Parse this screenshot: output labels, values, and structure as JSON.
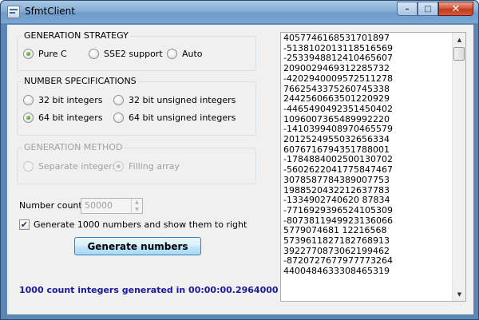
{
  "window": {
    "title": "SfmtClient"
  },
  "caption": {
    "minimize": "–",
    "maximize": "□",
    "close": "✕"
  },
  "strategy": {
    "title": "GENERATION STRATEGY",
    "options": [
      "Pure C",
      "SSE2 support",
      "Auto"
    ],
    "selected": "Pure C"
  },
  "specs": {
    "title": "NUMBER SPECIFICATIONS",
    "options": [
      "32 bit integers",
      "32 bit unsigned integers",
      "64 bit integers",
      "64 bit unsigned integers"
    ],
    "selected": "64 bit integers"
  },
  "method": {
    "title": "GENERATION METHOD",
    "options": [
      "Separate integers",
      "Filling array"
    ],
    "selected": "Filling array"
  },
  "count": {
    "label": "Number count :",
    "value": "50000"
  },
  "show_option": {
    "label": "Generate 1000 numbers and show them to right",
    "checked": true
  },
  "generate_button": {
    "label": "Generate numbers"
  },
  "status": {
    "text": "1000 count integers generated in 00:00:00.2964000"
  },
  "output": {
    "lines": [
      "4057746168531701897",
      "-5138102013118516569",
      "-2533948812410465607",
      "2090029469312285732",
      "-4202940009572511278",
      "7662543375260745338",
      "2442560663501220929",
      "-4465490492351450402",
      "1096007365489992220",
      "-1410399408970465579",
      "2012524955032656334",
      "6076716794351788001",
      "-1784884002500130702",
      "-5602622041775847467",
      "3078587784389007753",
      "1988520432212637783",
      "-1334902740620 87834",
      "-7716929396524105309",
      "-8073811949923136066",
      "5779074681 12216568",
      "5739611827182768913",
      "3922770873062199462",
      "-8720727677977773264",
      "4400484633308465319"
    ]
  },
  "icons": {
    "app": "window-app-icon",
    "check": "✔",
    "up": "▲",
    "down": "▼"
  }
}
